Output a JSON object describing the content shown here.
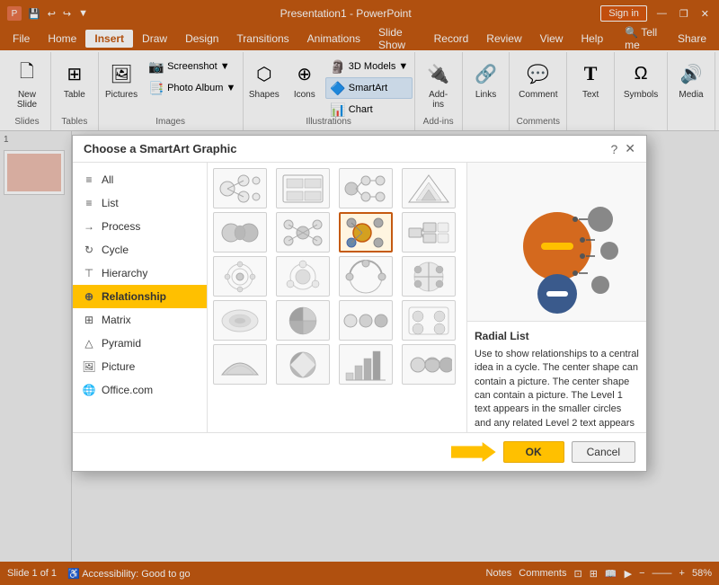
{
  "titleBar": {
    "appName": "Presentation1 - PowerPoint",
    "signIn": "Sign in",
    "undoIcon": "↩",
    "redoIcon": "↪",
    "saveIcon": "💾",
    "minimizeIcon": "—",
    "restoreIcon": "❐",
    "closeIcon": "✕"
  },
  "menuBar": {
    "items": [
      "File",
      "Home",
      "Insert",
      "Draw",
      "Design",
      "Transitions",
      "Animations",
      "Slide Show",
      "Record",
      "Review",
      "View",
      "Help",
      "Tell me",
      "Share"
    ]
  },
  "ribbon": {
    "groups": [
      {
        "label": "Slides",
        "buttons": [
          {
            "icon": "🗋",
            "label": "New\nSlide"
          }
        ]
      },
      {
        "label": "Tables",
        "buttons": [
          {
            "icon": "⊞",
            "label": "Table"
          }
        ]
      },
      {
        "label": "Images",
        "buttons": [
          {
            "icon": "🖼",
            "label": "Pictures"
          },
          {
            "icon": "📷",
            "label": "Screenshot"
          },
          {
            "icon": "📑",
            "label": "Photo Album"
          }
        ]
      },
      {
        "label": "Illustrations",
        "buttons": [
          {
            "icon": "⬡",
            "label": "Shapes"
          },
          {
            "icon": "⊕",
            "label": "Icons"
          },
          {
            "icon": "🗿",
            "label": "3D Models"
          },
          {
            "icon": "🔷",
            "label": "SmartArt"
          },
          {
            "icon": "📊",
            "label": "Chart"
          }
        ]
      },
      {
        "label": "Add-ins",
        "buttons": [
          {
            "icon": "🔌",
            "label": "Add-\nins"
          }
        ]
      },
      {
        "label": "",
        "buttons": [
          {
            "icon": "🔗",
            "label": "Links"
          }
        ]
      },
      {
        "label": "Comments",
        "buttons": [
          {
            "icon": "💬",
            "label": "Comment"
          }
        ]
      },
      {
        "label": "",
        "buttons": [
          {
            "icon": "T",
            "label": "Text"
          }
        ]
      },
      {
        "label": "",
        "buttons": [
          {
            "icon": "Ω",
            "label": "Symbols"
          }
        ]
      },
      {
        "label": "",
        "buttons": [
          {
            "icon": "🔊",
            "label": "Media"
          }
        ]
      }
    ]
  },
  "dialog": {
    "title": "Choose a SmartArt Graphic",
    "helpIcon": "?",
    "closeIcon": "✕",
    "categories": [
      {
        "id": "all",
        "label": "All",
        "icon": "≡"
      },
      {
        "id": "list",
        "label": "List",
        "icon": "≡"
      },
      {
        "id": "process",
        "label": "Process",
        "icon": "→"
      },
      {
        "id": "cycle",
        "label": "Cycle",
        "icon": "↻"
      },
      {
        "id": "hierarchy",
        "label": "Hierarchy",
        "icon": "⊤"
      },
      {
        "id": "relationship",
        "label": "Relationship",
        "icon": "⊕",
        "selected": true
      },
      {
        "id": "matrix",
        "label": "Matrix",
        "icon": "⊞"
      },
      {
        "id": "pyramid",
        "label": "Pyramid",
        "icon": "△"
      },
      {
        "id": "picture",
        "label": "Picture",
        "icon": "🖼"
      },
      {
        "id": "office",
        "label": "Office.com",
        "icon": "🌐"
      }
    ],
    "selectedItem": {
      "name": "Radial List",
      "description": "Use to show relationships to a central idea in a cycle. The center shape can contain a picture. The center shape can contain a picture. The Level 1 text appears in the smaller circles and any related Level 2 text appears to the side of the smaller circles."
    },
    "okButton": "OK",
    "cancelButton": "Cancel"
  },
  "statusBar": {
    "slideInfo": "Slide 1 of 1",
    "accessibility": "Accessibility: Good to go",
    "notesLabel": "Notes",
    "commentsLabel": "Comments",
    "zoomLevel": "58%"
  }
}
